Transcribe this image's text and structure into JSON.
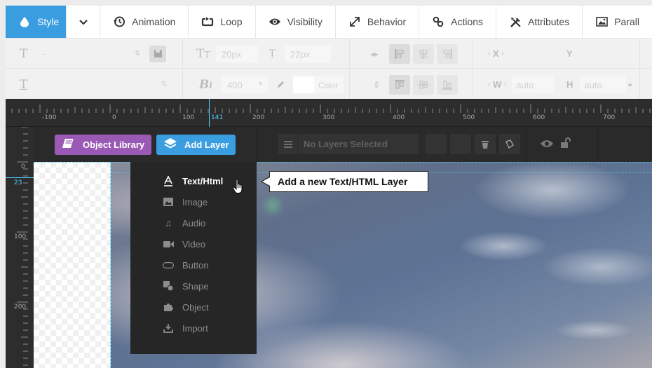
{
  "tabs": [
    {
      "label": "Style",
      "icon": "droplet-icon",
      "active": true
    },
    {
      "label": "Animation",
      "icon": "history-icon"
    },
    {
      "label": "Loop",
      "icon": "loop-icon"
    },
    {
      "label": "Visibility",
      "icon": "eye-icon"
    },
    {
      "label": "Behavior",
      "icon": "resize-icon"
    },
    {
      "label": "Actions",
      "icon": "link-icon"
    },
    {
      "label": "Attributes",
      "icon": "tools-icon"
    },
    {
      "label": "Parall",
      "icon": "image-icon"
    }
  ],
  "settings": {
    "font_family_value": "-",
    "font_size_value": "20px",
    "line_height_value": "22px",
    "font_weight_value": "400",
    "color_label": "Color",
    "x_label": "X",
    "y_label": "Y",
    "w_label": "W",
    "w_value": "auto",
    "h_label": "H",
    "h_value": "auto"
  },
  "ruler": {
    "labels": [
      "-100",
      "0",
      "100",
      "141",
      "200",
      "300",
      "400",
      "500",
      "600",
      "700"
    ],
    "vlabels": [
      "0",
      "23",
      "100",
      "200"
    ]
  },
  "toolbar": {
    "object_library_label": "Object Library",
    "add_layer_label": "Add Layer",
    "layer_select_placeholder": "No Layers Selected"
  },
  "add_layer_menu": [
    {
      "label": "Text/Html",
      "icon": "text-icon"
    },
    {
      "label": "Image",
      "icon": "image-icon"
    },
    {
      "label": "Audio",
      "icon": "music-note-icon"
    },
    {
      "label": "Video",
      "icon": "video-camera-icon"
    },
    {
      "label": "Button",
      "icon": "button-shape-icon"
    },
    {
      "label": "Shape",
      "icon": "shape-icon"
    },
    {
      "label": "Object",
      "icon": "puzzle-icon"
    },
    {
      "label": "Import",
      "icon": "import-icon"
    }
  ],
  "tooltip": {
    "text": "Add a new Text/HTML Layer"
  },
  "colors": {
    "accent_blue": "#3a9de0",
    "library_purple": "#9b59b6",
    "guide_cyan": "#4fd2ff"
  }
}
